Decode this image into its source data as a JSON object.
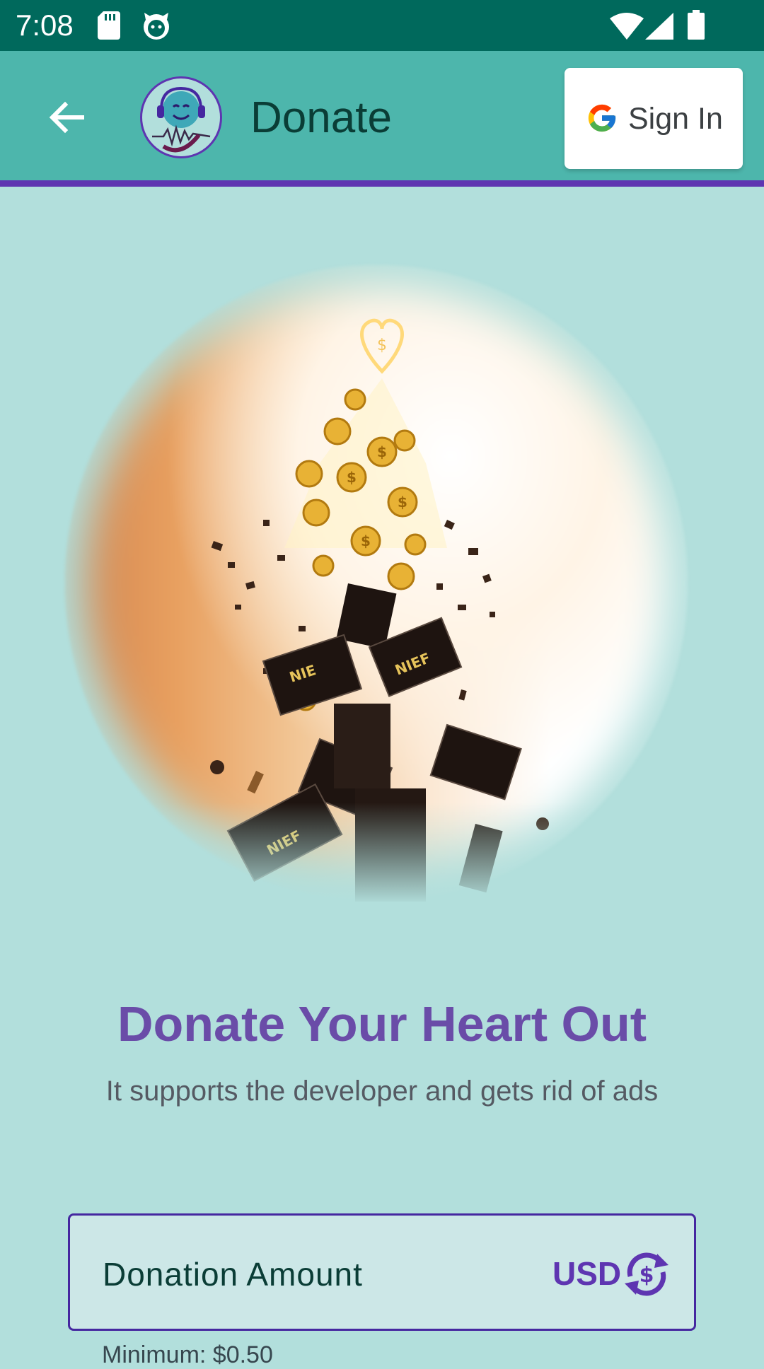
{
  "status_bar": {
    "time": "7:08",
    "icons": [
      "sd-card-icon",
      "cat-icon",
      "wifi-icon",
      "signal-icon",
      "battery-icon"
    ]
  },
  "app_bar": {
    "back_icon": "arrow-left-icon",
    "title": "Donate",
    "sign_in_label": "Sign In",
    "accent_color": "#5e35b1",
    "background_color": "#4db6ac"
  },
  "hero": {
    "image": "coins-and-bills-rising-toward-heart"
  },
  "content": {
    "heading": "Donate Your Heart Out",
    "subheading": "It supports the developer and gets rid of ads"
  },
  "donation_field": {
    "label": "Donation Amount",
    "currency": "USD",
    "currency_icon": "currency-exchange-icon",
    "helper": "Minimum: $0.50"
  }
}
